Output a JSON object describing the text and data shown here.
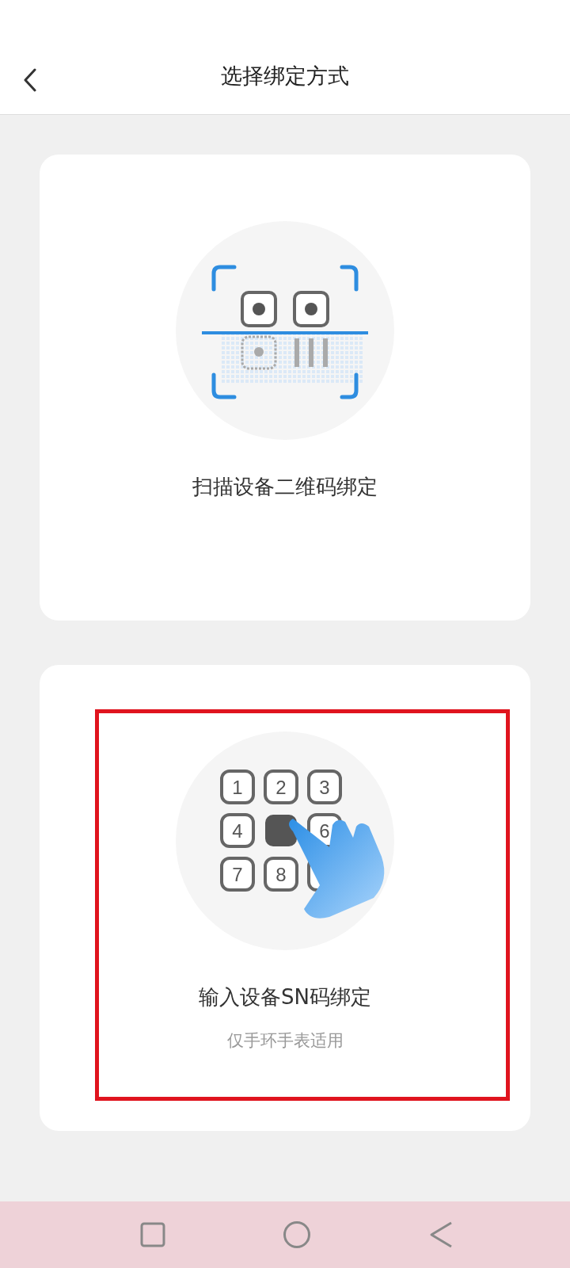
{
  "header": {
    "title": "选择绑定方式"
  },
  "options": [
    {
      "kind": "scan",
      "title": "扫描设备二维码绑定",
      "highlighted": false
    },
    {
      "kind": "keypad",
      "title": "输入设备SN码绑定",
      "subtitle": "仅手环手表适用",
      "highlighted": true,
      "keys": [
        {
          "kind": "key",
          "label": "1"
        },
        {
          "kind": "key",
          "label": "2"
        },
        {
          "kind": "key",
          "label": "3"
        },
        {
          "kind": "key",
          "label": "4"
        },
        {
          "kind": "pressed"
        },
        {
          "kind": "key",
          "label": "6"
        },
        {
          "kind": "key",
          "label": "7"
        },
        {
          "kind": "key",
          "label": "8"
        },
        {
          "kind": "blank"
        }
      ]
    }
  ]
}
